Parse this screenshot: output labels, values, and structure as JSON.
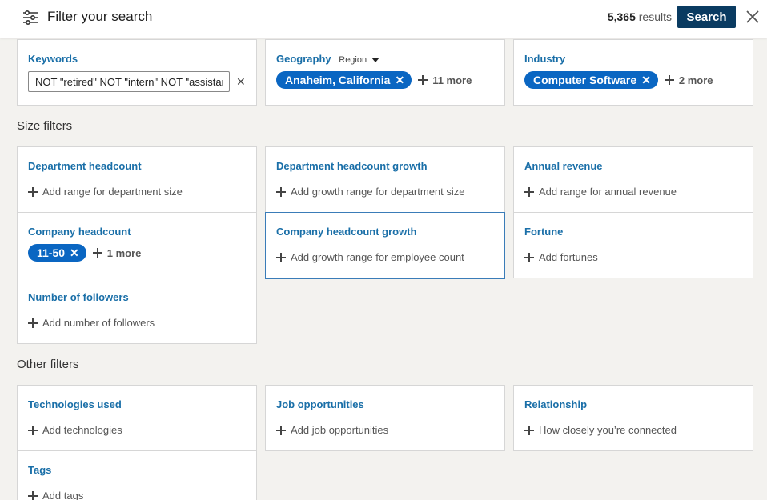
{
  "header": {
    "title": "Filter your search",
    "results_count": "5,365",
    "results_label": "results",
    "search_label": "Search"
  },
  "top_filters": {
    "keywords": {
      "title": "Keywords",
      "value": "NOT \"retired\" NOT \"intern\" NOT \"assistant\""
    },
    "geography": {
      "title": "Geography",
      "region_label": "Region",
      "selected": "Anaheim, California",
      "more": "11 more"
    },
    "industry": {
      "title": "Industry",
      "selected": "Computer Software",
      "more": "2 more"
    }
  },
  "size_filters": {
    "label": "Size filters",
    "department_headcount": {
      "title": "Department headcount",
      "add": "Add range for department size"
    },
    "department_headcount_growth": {
      "title": "Department headcount growth",
      "add": "Add growth range for department size"
    },
    "annual_revenue": {
      "title": "Annual revenue",
      "add": "Add range for annual revenue"
    },
    "company_headcount": {
      "title": "Company headcount",
      "selected": "11-50",
      "more": "1 more"
    },
    "company_headcount_growth": {
      "title": "Company headcount growth",
      "add": "Add growth range for employee count"
    },
    "fortune": {
      "title": "Fortune",
      "add": "Add fortunes"
    },
    "number_of_followers": {
      "title": "Number of followers",
      "add": "Add number of followers"
    }
  },
  "other_filters": {
    "label": "Other filters",
    "technologies_used": {
      "title": "Technologies used",
      "add": "Add technologies"
    },
    "job_opportunities": {
      "title": "Job opportunities",
      "add": "Add job opportunities"
    },
    "relationship": {
      "title": "Relationship",
      "add": "How closely you’re connected"
    },
    "tags": {
      "title": "Tags",
      "add": "Add tags"
    }
  },
  "icons": {
    "filter": "sliders-icon",
    "close": "close-icon",
    "plus": "plus-icon",
    "remove": "x-icon",
    "dropdown": "caret-down-icon"
  },
  "colors": {
    "primary_button": "#0a3b61",
    "pill": "#0a66c2",
    "title_link": "#1a6fa8",
    "highlight_border": "#3a7cb8"
  }
}
